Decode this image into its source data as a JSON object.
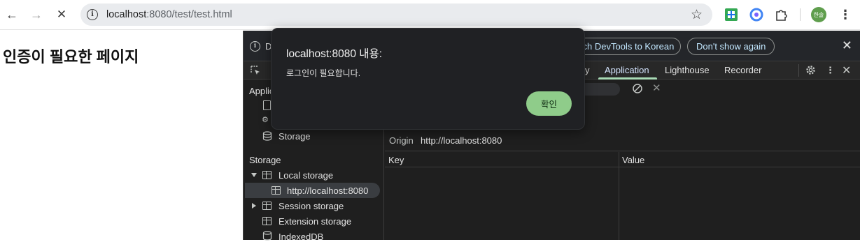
{
  "browser": {
    "url_host": "localhost",
    "url_rest": ":8080/test/test.html",
    "avatar_text": "한솔"
  },
  "page": {
    "heading": "인증이 필요한 페이지"
  },
  "devtools": {
    "banner": {
      "text_visible": "D",
      "switch_label": "Switch DevTools to Korean",
      "dont_show_label": "Don't show again"
    },
    "tabs": [
      {
        "label": "y"
      },
      {
        "label": "Application",
        "active": true
      },
      {
        "label": "Lighthouse"
      },
      {
        "label": "Recorder"
      }
    ],
    "sidebar": {
      "app_heading": "Applic",
      "storage_item": "Storage",
      "storage_heading": "Storage",
      "local_storage": "Local storage",
      "local_origin": "http://localhost:8080",
      "session_storage": "Session storage",
      "extension_storage": "Extension storage",
      "indexeddb": "IndexedDB"
    },
    "main": {
      "origin_label": "Origin",
      "origin_value": "http://localhost:8080",
      "col_key": "Key",
      "col_value": "Value"
    }
  },
  "alert": {
    "title": "localhost:8080 내용:",
    "message": "로그인이 필요합니다.",
    "ok_label": "확인"
  },
  "colors": {
    "accent_green": "#8fcc8a",
    "devtools_bg": "#1f1f1f",
    "tab_underline": "#a8dab5"
  }
}
